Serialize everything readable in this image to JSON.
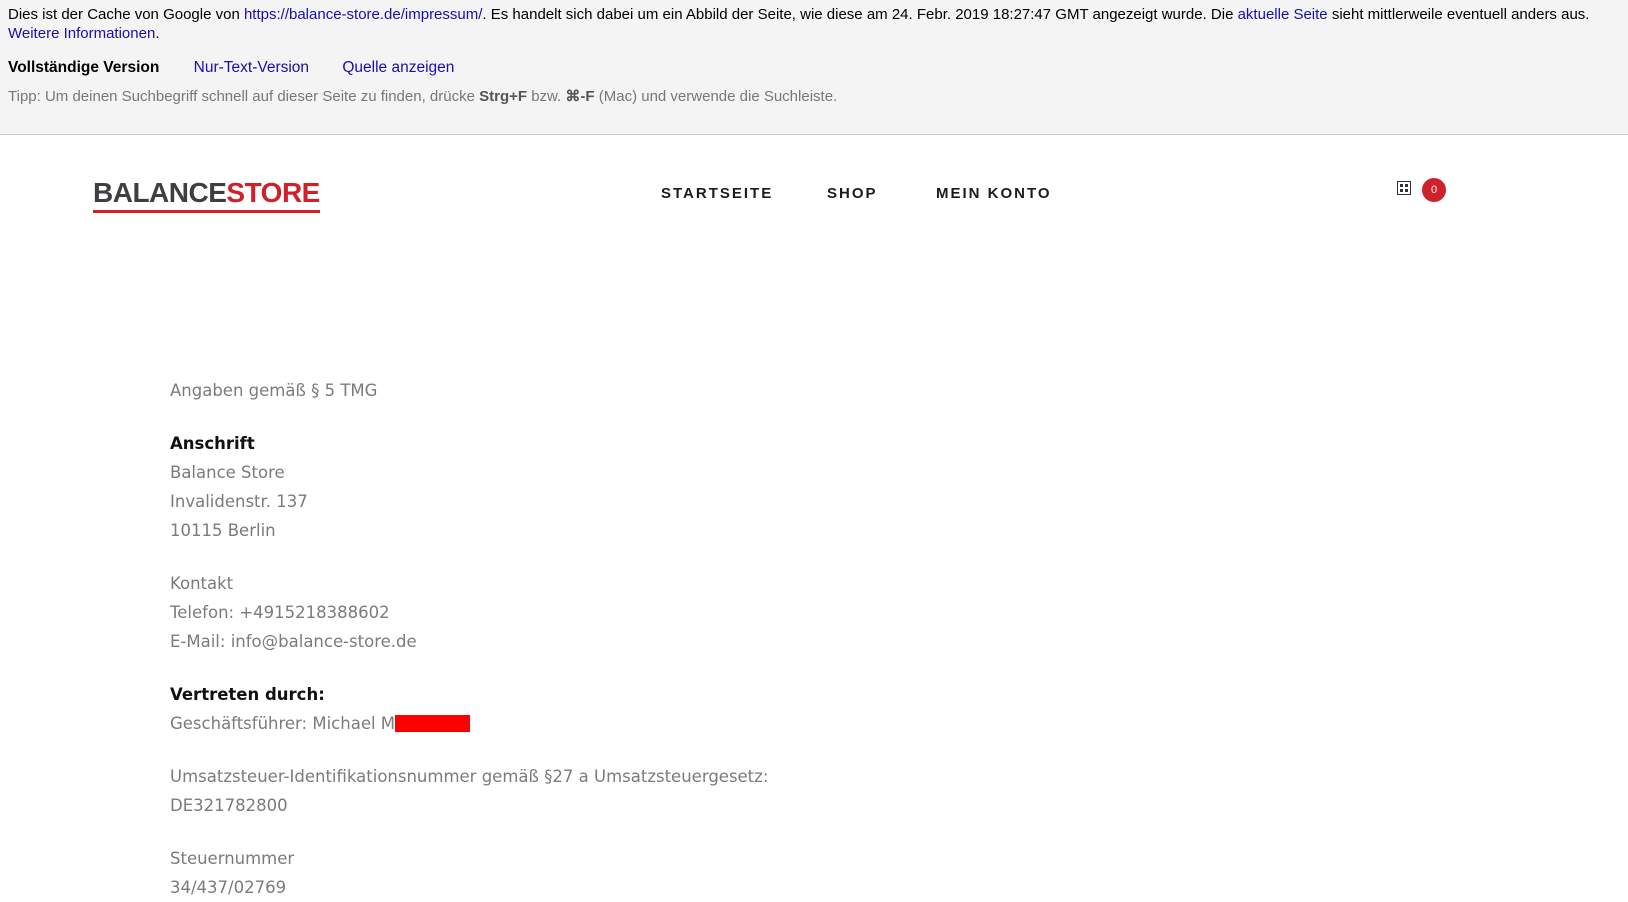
{
  "cache_banner": {
    "text_before_url": "Dies ist der Cache von Google von ",
    "url": "https://balance-store.de/impressum/",
    "text_after_url": ". Es handelt sich dabei um ein Abbild der Seite, wie diese am 24. Febr. 2019 18:27:47 GMT angezeigt wurde. Die ",
    "current_page_link": "aktuelle Seite",
    "text_after_current": " sieht mittlerweile eventuell anders aus. ",
    "more_info_link": "Weitere Informationen",
    "trailing_period": ".",
    "versions": {
      "full": "Vollständige Version",
      "text_only": "Nur-Text-Version",
      "view_source": "Quelle anzeigen"
    },
    "tip": {
      "prefix": "Tipp: Um deinen Suchbegriff schnell auf dieser Seite zu finden, drücke ",
      "shortcut_win": "Strg+F",
      "middle": " bzw. ",
      "shortcut_mac": "⌘-F",
      "suffix": " (Mac) und verwende die Suchleiste."
    }
  },
  "site": {
    "logo_part1": "BALANCE",
    "logo_part2": "STORE",
    "nav": [
      {
        "label": "STARTSEITE"
      },
      {
        "label": "SHOP"
      },
      {
        "label": "MEIN KONTO"
      }
    ],
    "cart_count": "0",
    "colors": {
      "brand_red": "#d0202a",
      "logo_dark": "#3d3f42",
      "body_text": "#7b7b7b"
    }
  },
  "impressum": {
    "intro": "Angaben gemäß § 5 TMG",
    "address_heading": "Anschrift",
    "address_lines": [
      "Balance Store",
      "Invalidenstr. 137",
      "10115 Berlin"
    ],
    "contact_heading": "Kontakt",
    "phone": "Telefon: +4915218388602",
    "email": "E-Mail: info@balance-store.de",
    "represented_heading": "Vertreten durch:",
    "managing_director": "Geschäftsführer: Michael M",
    "vat_label": "Umsatzsteuer-Identifikationsnummer gemäß §27 a Umsatzsteuergesetz:",
    "vat_id": "DE321782800",
    "tax_label": "Steuernummer",
    "tax_number": "34/437/02769"
  }
}
